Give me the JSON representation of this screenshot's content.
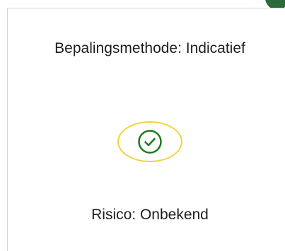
{
  "card": {
    "method_label": "Bepalingsmethode: Indicatief",
    "risk_label": "Risico: Onbekend",
    "status_icon": "check-circle-icon"
  },
  "colors": {
    "check_green": "#1f7a1f",
    "highlight_yellow": "#f2d23c",
    "badge_green": "#2b6a3a",
    "border_gray": "#d6d6d6",
    "text_dark": "#1f1f1f"
  }
}
